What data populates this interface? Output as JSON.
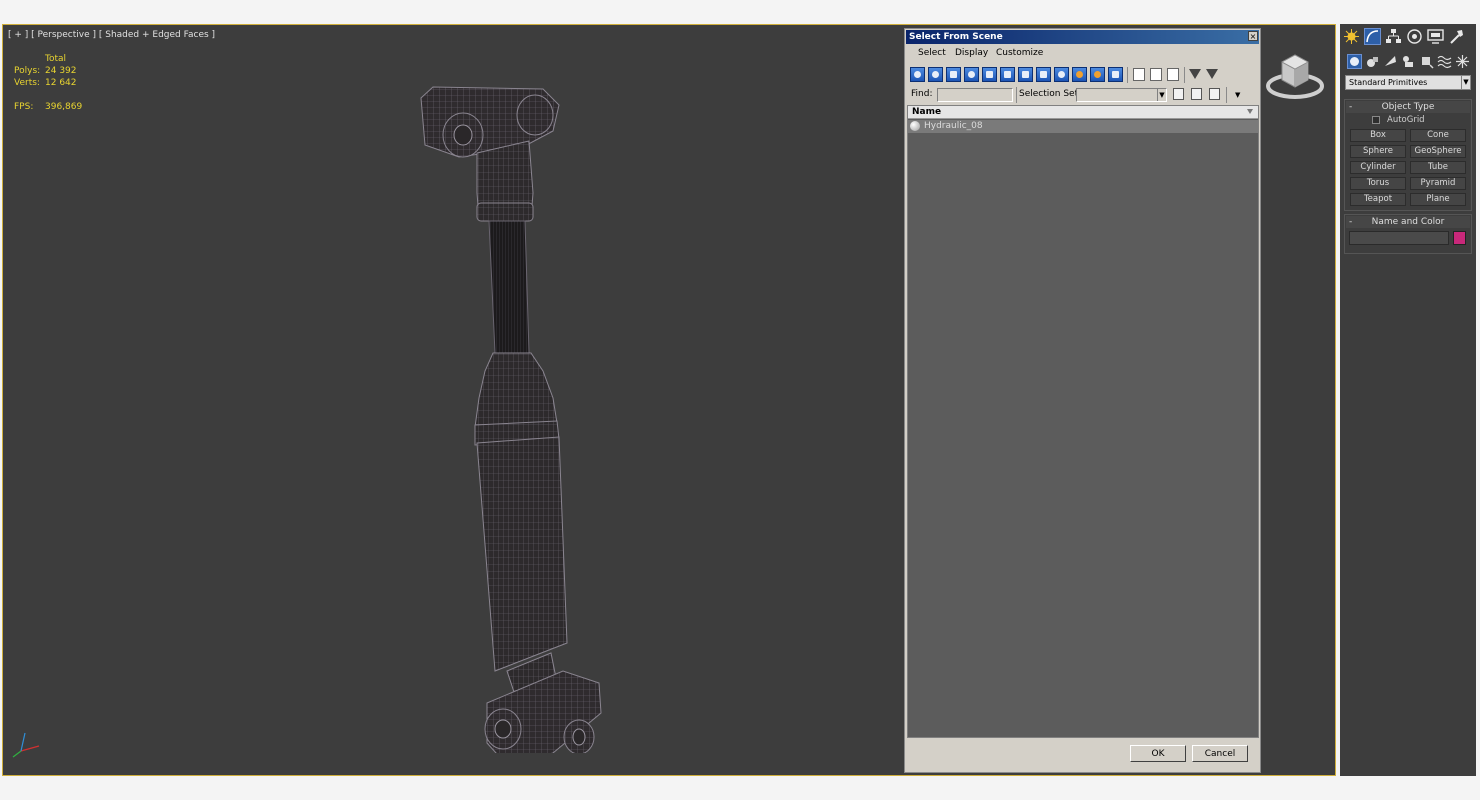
{
  "viewport": {
    "label": "[ + ] [ Perspective ] [ Shaded + Edged Faces ]",
    "stats": {
      "total_label": "Total",
      "polys_label": "Polys:",
      "polys_value": "24 392",
      "verts_label": "Verts:",
      "verts_value": "12 642",
      "fps_label": "FPS:",
      "fps_value": "396,869"
    }
  },
  "dialog": {
    "title": "Select From Scene",
    "close": "×",
    "menu": [
      "Select",
      "Display",
      "Customize"
    ],
    "find_label": "Find:",
    "find_value": "",
    "selection_set_label": "Selection Set:",
    "selection_set_value": "",
    "list_header": "Name",
    "rows": [
      {
        "name": "Hydraulic_08"
      }
    ],
    "ok_label": "OK",
    "cancel_label": "Cancel"
  },
  "command_panel": {
    "category_dropdown": "Standard Primitives",
    "object_type": {
      "title": "Object Type",
      "autogrid_label": "AutoGrid",
      "buttons": [
        "Box",
        "Cone",
        "Sphere",
        "GeoSphere",
        "Cylinder",
        "Tube",
        "Torus",
        "Pyramid",
        "Teapot",
        "Plane"
      ]
    },
    "name_and_color": {
      "title": "Name and Color",
      "name_value": "",
      "color": "#c8287a"
    }
  },
  "colors": {
    "viewport_bg": "#3d3d3d",
    "active_viewport_border": "#cfae3a",
    "stats_text": "#e8d430",
    "dialog_title_bar": "#0a246a",
    "toolbar_button": "#2f6fd0"
  }
}
